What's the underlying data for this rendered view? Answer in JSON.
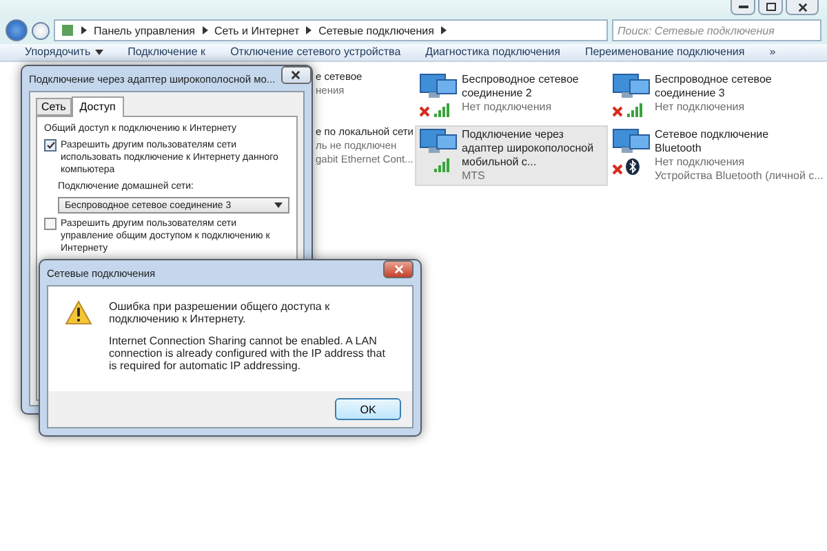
{
  "explorer": {
    "breadcrumb": [
      "Панель управления",
      "Сеть и Интернет",
      "Сетевые подключения"
    ],
    "search": {
      "placeholder": "Поиск: Сетевые подключения"
    },
    "toolbar": [
      "Упорядочить",
      "Подключение к",
      "Отключение сетевого устройства",
      "Диагностика подключения",
      "Переименование подключения",
      "»"
    ],
    "partial_items": [
      {
        "lines": [
          "е сетевое",
          "нения"
        ]
      },
      {
        "lines": [
          "е по локальной сети",
          "ль не подключен",
          "gabit Ethernet Cont..."
        ]
      }
    ],
    "connections": [
      {
        "name": "Беспроводное сетевое соединение 2",
        "status": "Нет подключения",
        "kind": "signal",
        "disconnected": true,
        "selected": false
      },
      {
        "name": "Беспроводное сетевое соединение 3",
        "status": "Нет подключения",
        "kind": "signal",
        "disconnected": true,
        "selected": false
      },
      {
        "name": "Подключение через адаптер широкополосной мобильной с...",
        "status": "MTS",
        "kind": "signal",
        "disconnected": false,
        "selected": true
      },
      {
        "name": "Сетевое подключение Bluetooth",
        "status": "Нет подключения",
        "device": "Устройства Bluetooth (личной с...",
        "kind": "bluetooth",
        "disconnected": true,
        "selected": false
      }
    ]
  },
  "properties": {
    "title": "Подключение через адаптер широкополосной мо...",
    "tabs": [
      {
        "label": "Сеть",
        "selected": false
      },
      {
        "label": "Доступ",
        "selected": true
      }
    ],
    "group": "Общий доступ к подключению к Интернету",
    "allow_use": {
      "label": "Разрешить другим пользователям сети использовать подключение к Интернету данного компьютера",
      "checked": true
    },
    "home_label": "Подключение домашней сети:",
    "home_value": "Беспроводное сетевое соединение 3",
    "allow_control": {
      "label": "Разрешить другим пользователям сети управление общим доступом к подключению к Интернету",
      "checked": false
    }
  },
  "error": {
    "title": "Сетевые подключения",
    "heading": "Ошибка при разрешении общего доступа к подключению к Интернету.",
    "message": "Internet Connection Sharing cannot be enabled.  A LAN connection is already configured with the IP address that is required for automatic IP addressing.",
    "button": "OK"
  }
}
